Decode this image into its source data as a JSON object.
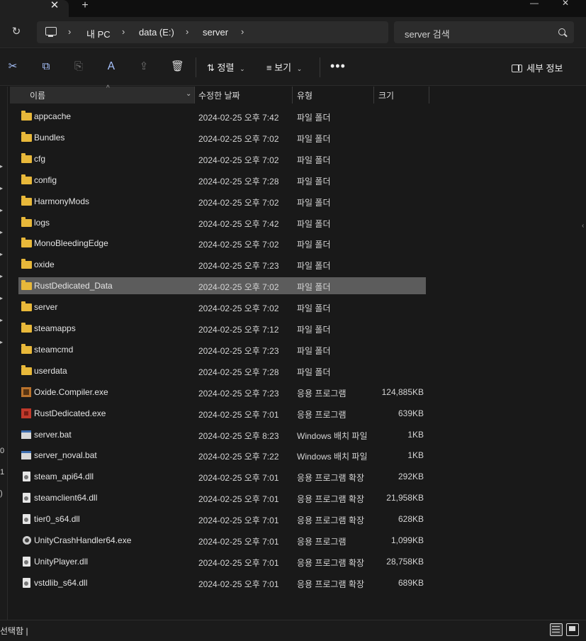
{
  "tabs": {
    "close_glyph": "✕",
    "new_glyph": "+"
  },
  "window": {
    "minimize_glyph": "—",
    "close_glyph": "✕"
  },
  "address": {
    "refresh_glyph": "↻",
    "crumbs": [
      "내 PC",
      "data (E:)",
      "server"
    ],
    "chevron": "›",
    "search_placeholder": "server 검색"
  },
  "toolbar": {
    "cut_glyph": "✂",
    "copy_glyph": "⧉",
    "paste_glyph": "⎘",
    "rename_glyph": "Ａ",
    "share_glyph": "⇪",
    "delete_glyph": "🗑",
    "sort_label": "정렬",
    "sort_glyph": "⇅",
    "view_label": "보기",
    "view_glyph": "≡",
    "caret": "⌄",
    "more_label": "•••",
    "details_label": "세부 정보"
  },
  "columns": {
    "name": "이름",
    "date": "수정한 날짜",
    "type": "유형",
    "size": "크기",
    "sort_caret": "^",
    "dropdown_caret": "⌄"
  },
  "files": [
    {
      "name": "appcache",
      "date": "2024-02-25 오후 7:42",
      "type": "파일 폴더",
      "size": "",
      "icon": "folder"
    },
    {
      "name": "Bundles",
      "date": "2024-02-25 오후 7:02",
      "type": "파일 폴더",
      "size": "",
      "icon": "folder"
    },
    {
      "name": "cfg",
      "date": "2024-02-25 오후 7:02",
      "type": "파일 폴더",
      "size": "",
      "icon": "folder"
    },
    {
      "name": "config",
      "date": "2024-02-25 오후 7:28",
      "type": "파일 폴더",
      "size": "",
      "icon": "folder"
    },
    {
      "name": "HarmonyMods",
      "date": "2024-02-25 오후 7:02",
      "type": "파일 폴더",
      "size": "",
      "icon": "folder"
    },
    {
      "name": "logs",
      "date": "2024-02-25 오후 7:42",
      "type": "파일 폴더",
      "size": "",
      "icon": "folder"
    },
    {
      "name": "MonoBleedingEdge",
      "date": "2024-02-25 오후 7:02",
      "type": "파일 폴더",
      "size": "",
      "icon": "folder"
    },
    {
      "name": "oxide",
      "date": "2024-02-25 오후 7:23",
      "type": "파일 폴더",
      "size": "",
      "icon": "folder"
    },
    {
      "name": "RustDedicated_Data",
      "date": "2024-02-25 오후 7:02",
      "type": "파일 폴더",
      "size": "",
      "icon": "folder",
      "selected": true
    },
    {
      "name": "server",
      "date": "2024-02-25 오후 7:02",
      "type": "파일 폴더",
      "size": "",
      "icon": "folder"
    },
    {
      "name": "steamapps",
      "date": "2024-02-25 오후 7:12",
      "type": "파일 폴더",
      "size": "",
      "icon": "folder"
    },
    {
      "name": "steamcmd",
      "date": "2024-02-25 오후 7:23",
      "type": "파일 폴더",
      "size": "",
      "icon": "folder"
    },
    {
      "name": "userdata",
      "date": "2024-02-25 오후 7:28",
      "type": "파일 폴더",
      "size": "",
      "icon": "folder"
    },
    {
      "name": "Oxide.Compiler.exe",
      "date": "2024-02-25 오후 7:23",
      "type": "응용 프로그램",
      "size": "124,885KB",
      "icon": "exe-oxide"
    },
    {
      "name": "RustDedicated.exe",
      "date": "2024-02-25 오후 7:01",
      "type": "응용 프로그램",
      "size": "639KB",
      "icon": "exe-rust"
    },
    {
      "name": "server.bat",
      "date": "2024-02-25 오후 8:23",
      "type": "Windows 배치 파일",
      "size": "1KB",
      "icon": "bat"
    },
    {
      "name": "server_noval.bat",
      "date": "2024-02-25 오후 7:22",
      "type": "Windows 배치 파일",
      "size": "1KB",
      "icon": "bat"
    },
    {
      "name": "steam_api64.dll",
      "date": "2024-02-25 오후 7:01",
      "type": "응용 프로그램 확장",
      "size": "292KB",
      "icon": "dll"
    },
    {
      "name": "steamclient64.dll",
      "date": "2024-02-25 오후 7:01",
      "type": "응용 프로그램 확장",
      "size": "21,958KB",
      "icon": "dll"
    },
    {
      "name": "tier0_s64.dll",
      "date": "2024-02-25 오후 7:01",
      "type": "응용 프로그램 확장",
      "size": "628KB",
      "icon": "dll"
    },
    {
      "name": "UnityCrashHandler64.exe",
      "date": "2024-02-25 오후 7:01",
      "type": "응용 프로그램",
      "size": "1,099KB",
      "icon": "crash"
    },
    {
      "name": "UnityPlayer.dll",
      "date": "2024-02-25 오후 7:01",
      "type": "응용 프로그램 확장",
      "size": "28,758KB",
      "icon": "dll"
    },
    {
      "name": "vstdlib_s64.dll",
      "date": "2024-02-25 오후 7:01",
      "type": "응용 프로그램 확장",
      "size": "689KB",
      "icon": "dll"
    }
  ],
  "navpane": {
    "numbers": [
      "0",
      "1",
      ")"
    ]
  },
  "status": {
    "text": "선택함  |"
  }
}
